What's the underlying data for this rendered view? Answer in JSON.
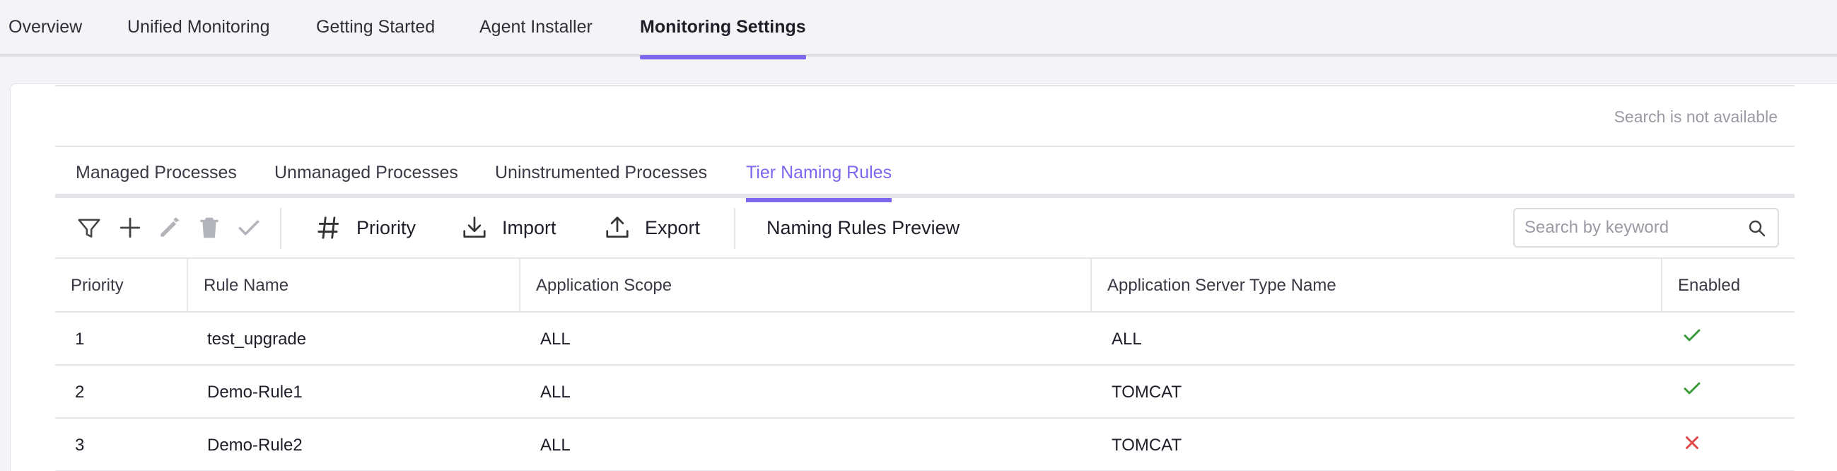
{
  "top_tabs": [
    {
      "label": "Overview",
      "active": false
    },
    {
      "label": "Unified Monitoring",
      "active": false
    },
    {
      "label": "Getting Started",
      "active": false
    },
    {
      "label": "Agent Installer",
      "active": false
    },
    {
      "label": "Monitoring Settings",
      "active": true
    }
  ],
  "search_note": "Search is not available",
  "sub_tabs": [
    {
      "label": "Managed Processes",
      "active": false
    },
    {
      "label": "Unmanaged Processes",
      "active": false
    },
    {
      "label": "Uninstrumented Processes",
      "active": false
    },
    {
      "label": "Tier Naming Rules",
      "active": true
    }
  ],
  "toolbar": {
    "icons": [
      "filter-icon",
      "plus-icon",
      "pencil-icon",
      "trash-icon",
      "check-icon"
    ],
    "priority_label": "Priority",
    "import_label": "Import",
    "export_label": "Export",
    "preview_label": "Naming Rules Preview",
    "search_placeholder": "Search by keyword"
  },
  "table": {
    "headers": [
      "Priority",
      "Rule Name",
      "Application Scope",
      "Application Server Type Name",
      "Enabled"
    ],
    "rows": [
      {
        "priority": "1",
        "rule_name": "test_upgrade",
        "scope": "ALL",
        "server_type": "ALL",
        "enabled": true
      },
      {
        "priority": "2",
        "rule_name": "Demo-Rule1",
        "scope": "ALL",
        "server_type": "TOMCAT",
        "enabled": true
      },
      {
        "priority": "3",
        "rule_name": "Demo-Rule2",
        "scope": "ALL",
        "server_type": "TOMCAT",
        "enabled": false
      }
    ]
  },
  "colors": {
    "accent": "#7b68ee",
    "enabled_true": "#3a9a3a",
    "enabled_false": "#e04848"
  }
}
